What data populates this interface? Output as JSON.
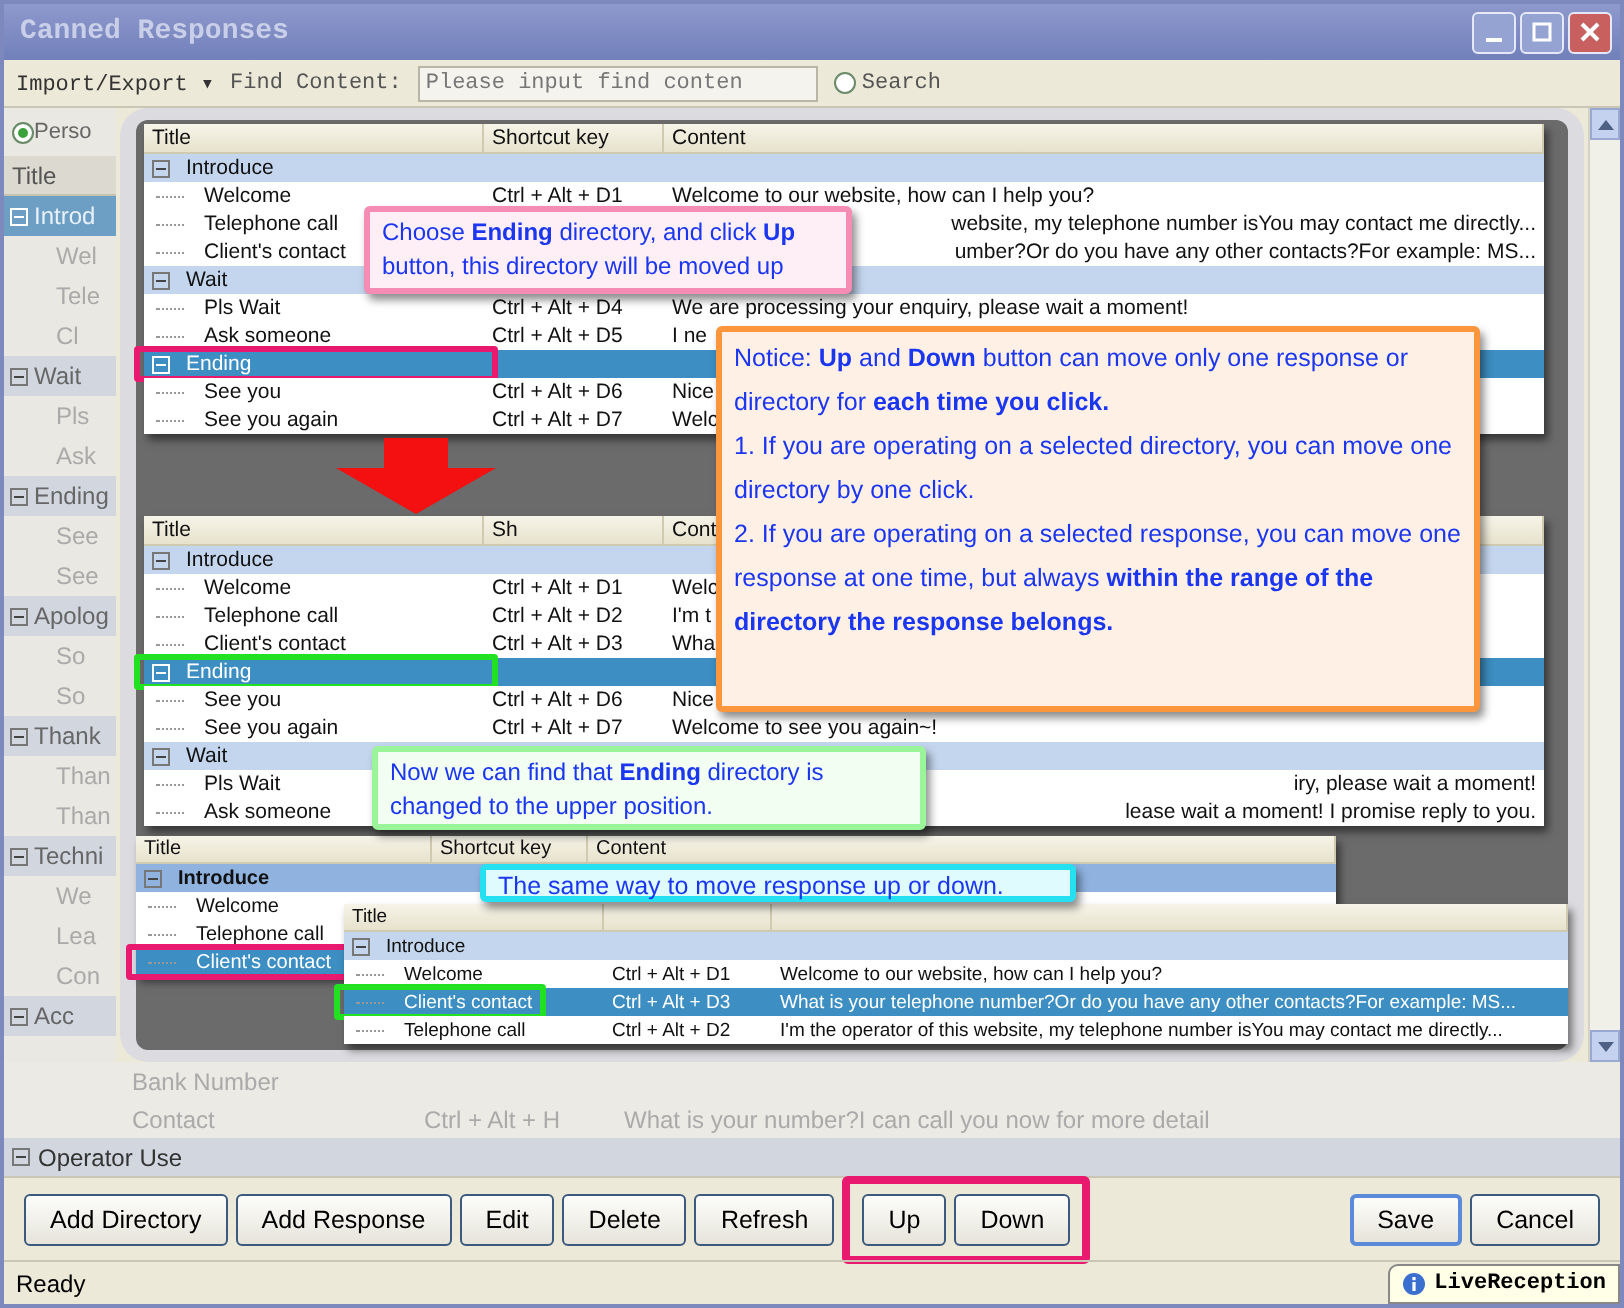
{
  "window": {
    "title": "Canned Responses"
  },
  "toolbar": {
    "menu": "Import/Export ▾",
    "find_label": "Find Content:",
    "find_field": {
      "placeholder": "Please input find conten"
    },
    "search": {
      "label": "Search",
      "selected": false
    }
  },
  "scope": {
    "label": "Perso",
    "selected": true
  },
  "tree": {
    "header": "Title",
    "rows": [
      {
        "kind": "group",
        "text": "Introd",
        "selected": true
      },
      {
        "kind": "item",
        "text": "Wel",
        "selected": false
      },
      {
        "kind": "item",
        "text": "Tele",
        "selected": false
      },
      {
        "kind": "item",
        "text": "Cl",
        "selected": false
      },
      {
        "kind": "group",
        "text": "Wait",
        "selected": false
      },
      {
        "kind": "item",
        "text": "Pls",
        "selected": false
      },
      {
        "kind": "item",
        "text": "Ask",
        "selected": false
      },
      {
        "kind": "group",
        "text": "Ending",
        "selected": false
      },
      {
        "kind": "item",
        "text": "See",
        "selected": false
      },
      {
        "kind": "item",
        "text": "See",
        "selected": false
      },
      {
        "kind": "group",
        "text": "Apolog",
        "selected": false
      },
      {
        "kind": "item",
        "text": "So",
        "selected": false
      },
      {
        "kind": "item",
        "text": "So",
        "selected": false
      },
      {
        "kind": "group",
        "text": "Thank",
        "selected": false
      },
      {
        "kind": "item",
        "text": "Than",
        "selected": false
      },
      {
        "kind": "item",
        "text": "Than",
        "selected": false
      },
      {
        "kind": "group",
        "text": "Techni",
        "selected": false
      },
      {
        "kind": "item",
        "text": "We",
        "selected": false
      },
      {
        "kind": "item",
        "text": "Lea",
        "selected": false
      },
      {
        "kind": "item",
        "text": "Con",
        "selected": false
      },
      {
        "kind": "group",
        "text": "Acc",
        "selected": false
      }
    ]
  },
  "tutorial": {
    "shots": [
      {
        "columns": [
          "Title",
          "Shortcut key",
          "Content"
        ],
        "rows": [
          {
            "kind": "group",
            "title": "Introduce",
            "selected": false
          },
          {
            "kind": "item",
            "title": "Welcome",
            "shortcut": "Ctrl + Alt + D1",
            "content": "Welcome to our website, how can I help you?",
            "selected": false
          },
          {
            "kind": "item",
            "title": "Telephone call",
            "content": "website, my telephone number isYou may contact me directly...",
            "content_cut_start": true,
            "selected": false
          },
          {
            "kind": "item",
            "title": "Client's contact",
            "content": "umber?Or do you have any other contacts?For example: MS...",
            "content_cut_start": true,
            "selected": false
          },
          {
            "kind": "group",
            "title": "Wait",
            "selected": false
          },
          {
            "kind": "item",
            "title": "Pls Wait",
            "shortcut": "Ctrl + Alt + D4",
            "content": "We are processing your enquiry, please wait a moment!",
            "selected": false
          },
          {
            "kind": "item",
            "title": "Ask someone",
            "shortcut": "Ctrl + Alt + D5",
            "content": "I ne",
            "selected": false
          },
          {
            "kind": "group",
            "title": "Ending",
            "selected": true,
            "color": "#e8196f"
          },
          {
            "kind": "item",
            "title": "See you",
            "shortcut": "Ctrl + Alt + D6",
            "content": "Nice",
            "selected": false
          },
          {
            "kind": "item",
            "title": "See you again",
            "shortcut": "Ctrl + Alt + D7",
            "content": "Welc",
            "selected": false
          }
        ]
      },
      {
        "columns": [
          "Title",
          "Sh",
          "Cont"
        ],
        "rows": [
          {
            "kind": "group",
            "title": "Introduce",
            "selected": false
          },
          {
            "kind": "item",
            "title": "Welcome",
            "shortcut": "Ctrl + Alt + D1",
            "content": "Welc",
            "selected": false
          },
          {
            "kind": "item",
            "title": "Telephone call",
            "shortcut": "Ctrl + Alt + D2",
            "content": "I'm t",
            "selected": false
          },
          {
            "kind": "item",
            "title": "Client's contact",
            "shortcut": "Ctrl + Alt + D3",
            "content": "Wha",
            "selected": false
          },
          {
            "kind": "group",
            "title": "Ending",
            "selected": true,
            "color": "#22e022"
          },
          {
            "kind": "item",
            "title": "See you",
            "shortcut": "Ctrl + Alt + D6",
            "content": "Nice",
            "selected": false
          },
          {
            "kind": "item",
            "title": "See you again",
            "shortcut": "Ctrl + Alt + D7",
            "content": "Welcome to see you again~!",
            "selected": false
          },
          {
            "kind": "group",
            "title": "Wait",
            "selected": false
          },
          {
            "kind": "item",
            "title": "Pls Wait",
            "content": "iry, please wait a moment!",
            "content_cut_start": true,
            "selected": false
          },
          {
            "kind": "item",
            "title": "Ask someone",
            "content": "lease wait a moment! I promise reply to you.",
            "content_cut_start": true,
            "selected": false
          }
        ]
      },
      {
        "columns": [
          "Title",
          "Shortcut key",
          "Content"
        ],
        "rows": [
          {
            "kind": "group",
            "title": "Introduce",
            "selected": true
          },
          {
            "kind": "item",
            "title": "Welcome",
            "selected": false
          },
          {
            "kind": "item",
            "title": "Telephone call",
            "selected": false
          },
          {
            "kind": "item",
            "title": "Client's contact",
            "selected": true,
            "color": "#e8196f"
          }
        ]
      },
      {
        "columns": [
          "Title"
        ],
        "rows": [
          {
            "kind": "group",
            "title": "Introduce",
            "selected": false
          },
          {
            "kind": "item",
            "title": "Welcome",
            "shortcut": "Ctrl + Alt + D1",
            "content": "Welcome to our website, how can I help you?",
            "selected": false
          },
          {
            "kind": "item",
            "title": "Client's contact",
            "shortcut": "Ctrl + Alt + D3",
            "content": "What is your telephone number?Or do you have any other contacts?For example: MS...",
            "selected": true,
            "color": "#22e022"
          },
          {
            "kind": "item",
            "title": "Telephone call",
            "shortcut": "Ctrl + Alt + D2",
            "content": "I'm the operator of this website, my telephone number isYou may contact me directly...",
            "selected": false
          }
        ]
      }
    ],
    "callouts": [
      {
        "color": "#f48cb4",
        "paragraphs": [
          "Choose **Ending** directory, and click **Up** button, this directory will be moved up"
        ]
      },
      {
        "color": "#fb963c",
        "paragraphs": [
          "Notice: **Up** and **Down** button can move only one response or directory for **each time you click.**",
          "1. If you are operating on a selected directory, you can move one directory by one click.",
          "2. If you are operating on a selected response, you can move one response at one time, but always **within the range of the directory the response belongs.**"
        ]
      },
      {
        "color": "#9af59a",
        "paragraphs": [
          "Now we can find that **Ending** directory is changed to the upper position."
        ]
      },
      {
        "color": "#25e0f0",
        "paragraphs": [
          "The same way to move response up or down."
        ]
      }
    ]
  },
  "tree_bottom": [
    {
      "kind": "item",
      "title": "Bank Number"
    },
    {
      "kind": "item",
      "title": "Contact",
      "shortcut": "Ctrl + Alt + H",
      "content": "What is your number?I can call you now for more detail"
    },
    {
      "kind": "group",
      "title": "Operator Use"
    }
  ],
  "buttons": {
    "left": [
      {
        "label": "Add Directory",
        "highlighted": false
      },
      {
        "label": "Add Response",
        "highlighted": false
      },
      {
        "label": "Edit",
        "highlighted": false
      },
      {
        "label": "Delete",
        "highlighted": false
      },
      {
        "label": "Refresh",
        "highlighted": false
      },
      {
        "label": "Up",
        "highlighted": true
      },
      {
        "label": "Down",
        "highlighted": true
      }
    ],
    "right": [
      {
        "label": "Save",
        "default": true
      },
      {
        "label": "Cancel",
        "default": false
      }
    ]
  },
  "status": {
    "text": "Ready",
    "notification": "LiveReception"
  }
}
